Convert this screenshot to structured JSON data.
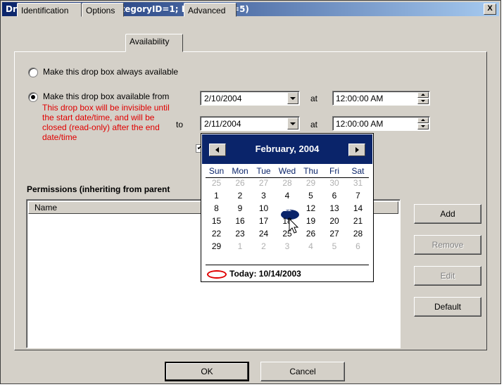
{
  "window": {
    "title": "Drop Box Properties (CategoryID=1; DropBoxID=5)",
    "close_glyph": "X"
  },
  "tabs": [
    {
      "label": "Identification",
      "active": false
    },
    {
      "label": "Options",
      "active": false
    },
    {
      "label": "Availability",
      "active": true
    },
    {
      "label": "Advanced",
      "active": false
    }
  ],
  "availability": {
    "always_label": "Make this drop box always available",
    "from_label": "Make this drop box available from",
    "note": "This drop box will be invisible until the start date/time, and will be closed (read-only) after the end date/time",
    "to_label": "to",
    "at_label": "at",
    "start_date": "2/10/2004",
    "start_time": "12:00:00 AM",
    "end_date": "2/11/2004",
    "end_time": "12:00:00 AM",
    "check_glyph": "✔"
  },
  "permissions": {
    "heading": "Permissions (inheriting from parent",
    "column_name": "Name"
  },
  "side_buttons": {
    "add": "Add",
    "remove": "Remove",
    "edit": "Edit",
    "default": "Default"
  },
  "footer": {
    "ok": "OK",
    "cancel": "Cancel"
  },
  "calendar": {
    "month_label": "February, 2004",
    "days_of_week": [
      "Sun",
      "Mon",
      "Tue",
      "Wed",
      "Thu",
      "Fri",
      "Sat"
    ],
    "weeks": [
      [
        "25",
        "26",
        "27",
        "28",
        "29",
        "30",
        "31"
      ],
      [
        "1",
        "2",
        "3",
        "4",
        "5",
        "6",
        "7"
      ],
      [
        "8",
        "9",
        "10",
        "11",
        "12",
        "13",
        "14"
      ],
      [
        "15",
        "16",
        "17",
        "18",
        "19",
        "20",
        "21"
      ],
      [
        "22",
        "23",
        "24",
        "25",
        "26",
        "27",
        "28"
      ],
      [
        "29",
        "1",
        "2",
        "3",
        "4",
        "5",
        "6"
      ]
    ],
    "selected_day": "11",
    "today_label": "Today: 10/14/2003"
  }
}
